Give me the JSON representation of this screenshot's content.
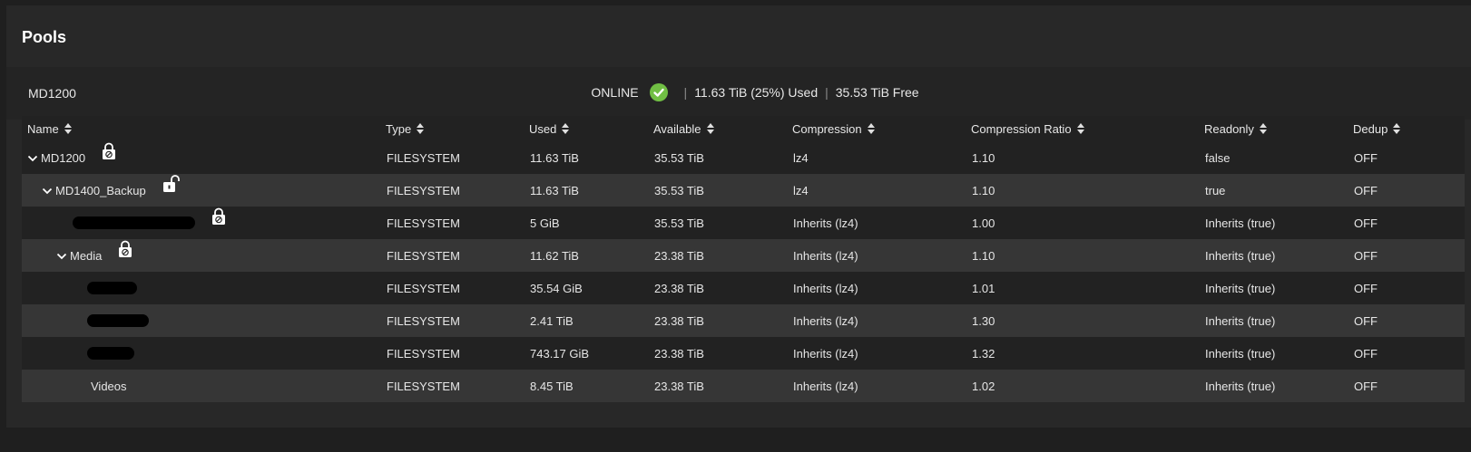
{
  "title": "Pools",
  "pool": {
    "name": "MD1200",
    "status": "ONLINE",
    "used": "11.63 TiB (25%) Used",
    "free": "35.53 TiB Free",
    "separator": "|"
  },
  "colors": {
    "status_ok": "#71bf44",
    "row_dark": "#222222",
    "row_light": "#363636"
  },
  "columns": [
    "Name",
    "Type",
    "Used",
    "Available",
    "Compression",
    "Compression Ratio",
    "Readonly",
    "Dedup"
  ],
  "rows": [
    {
      "name": "MD1200",
      "level": 0,
      "expanded": true,
      "lock": "locked-icon",
      "type": "FILESYSTEM",
      "used": "11.63 TiB",
      "available": "35.53 TiB",
      "compression": "lz4",
      "ratio": "1.10",
      "readonly": "false",
      "dedup": "OFF"
    },
    {
      "name": "MD1400_Backup",
      "level": 1,
      "expanded": true,
      "lock": "unlocked-icon",
      "type": "FILESYSTEM",
      "used": "11.63 TiB",
      "available": "35.53 TiB",
      "compression": "lz4",
      "ratio": "1.10",
      "readonly": "true",
      "dedup": "OFF"
    },
    {
      "name": "",
      "redacted": true,
      "level": 2,
      "expanded": false,
      "lock": "locked-icon",
      "type": "FILESYSTEM",
      "used": "5 GiB",
      "available": "35.53 TiB",
      "compression": "Inherits (lz4)",
      "ratio": "1.00",
      "readonly": "Inherits (true)",
      "dedup": "OFF"
    },
    {
      "name": "Media",
      "level": 2,
      "expanded": true,
      "lock": "locked-icon",
      "type": "FILESYSTEM",
      "used": "11.62 TiB",
      "available": "23.38 TiB",
      "compression": "Inherits (lz4)",
      "ratio": "1.10",
      "readonly": "Inherits (true)",
      "dedup": "OFF"
    },
    {
      "name": "",
      "redacted": true,
      "level": 3,
      "expanded": false,
      "lock": "",
      "type": "FILESYSTEM",
      "used": "35.54 GiB",
      "available": "23.38 TiB",
      "compression": "Inherits (lz4)",
      "ratio": "1.01",
      "readonly": "Inherits (true)",
      "dedup": "OFF"
    },
    {
      "name": "",
      "redacted": true,
      "level": 3,
      "expanded": false,
      "lock": "",
      "type": "FILESYSTEM",
      "used": "2.41 TiB",
      "available": "23.38 TiB",
      "compression": "Inherits (lz4)",
      "ratio": "1.30",
      "readonly": "Inherits (true)",
      "dedup": "OFF"
    },
    {
      "name": "",
      "redacted": true,
      "level": 3,
      "expanded": false,
      "lock": "",
      "type": "FILESYSTEM",
      "used": "743.17 GiB",
      "available": "23.38 TiB",
      "compression": "Inherits (lz4)",
      "ratio": "1.32",
      "readonly": "Inherits (true)",
      "dedup": "OFF"
    },
    {
      "name": "Videos",
      "level": 3,
      "expanded": false,
      "lock": "",
      "type": "FILESYSTEM",
      "used": "8.45 TiB",
      "available": "23.38 TiB",
      "compression": "Inherits (lz4)",
      "ratio": "1.02",
      "readonly": "Inherits (true)",
      "dedup": "OFF"
    }
  ]
}
